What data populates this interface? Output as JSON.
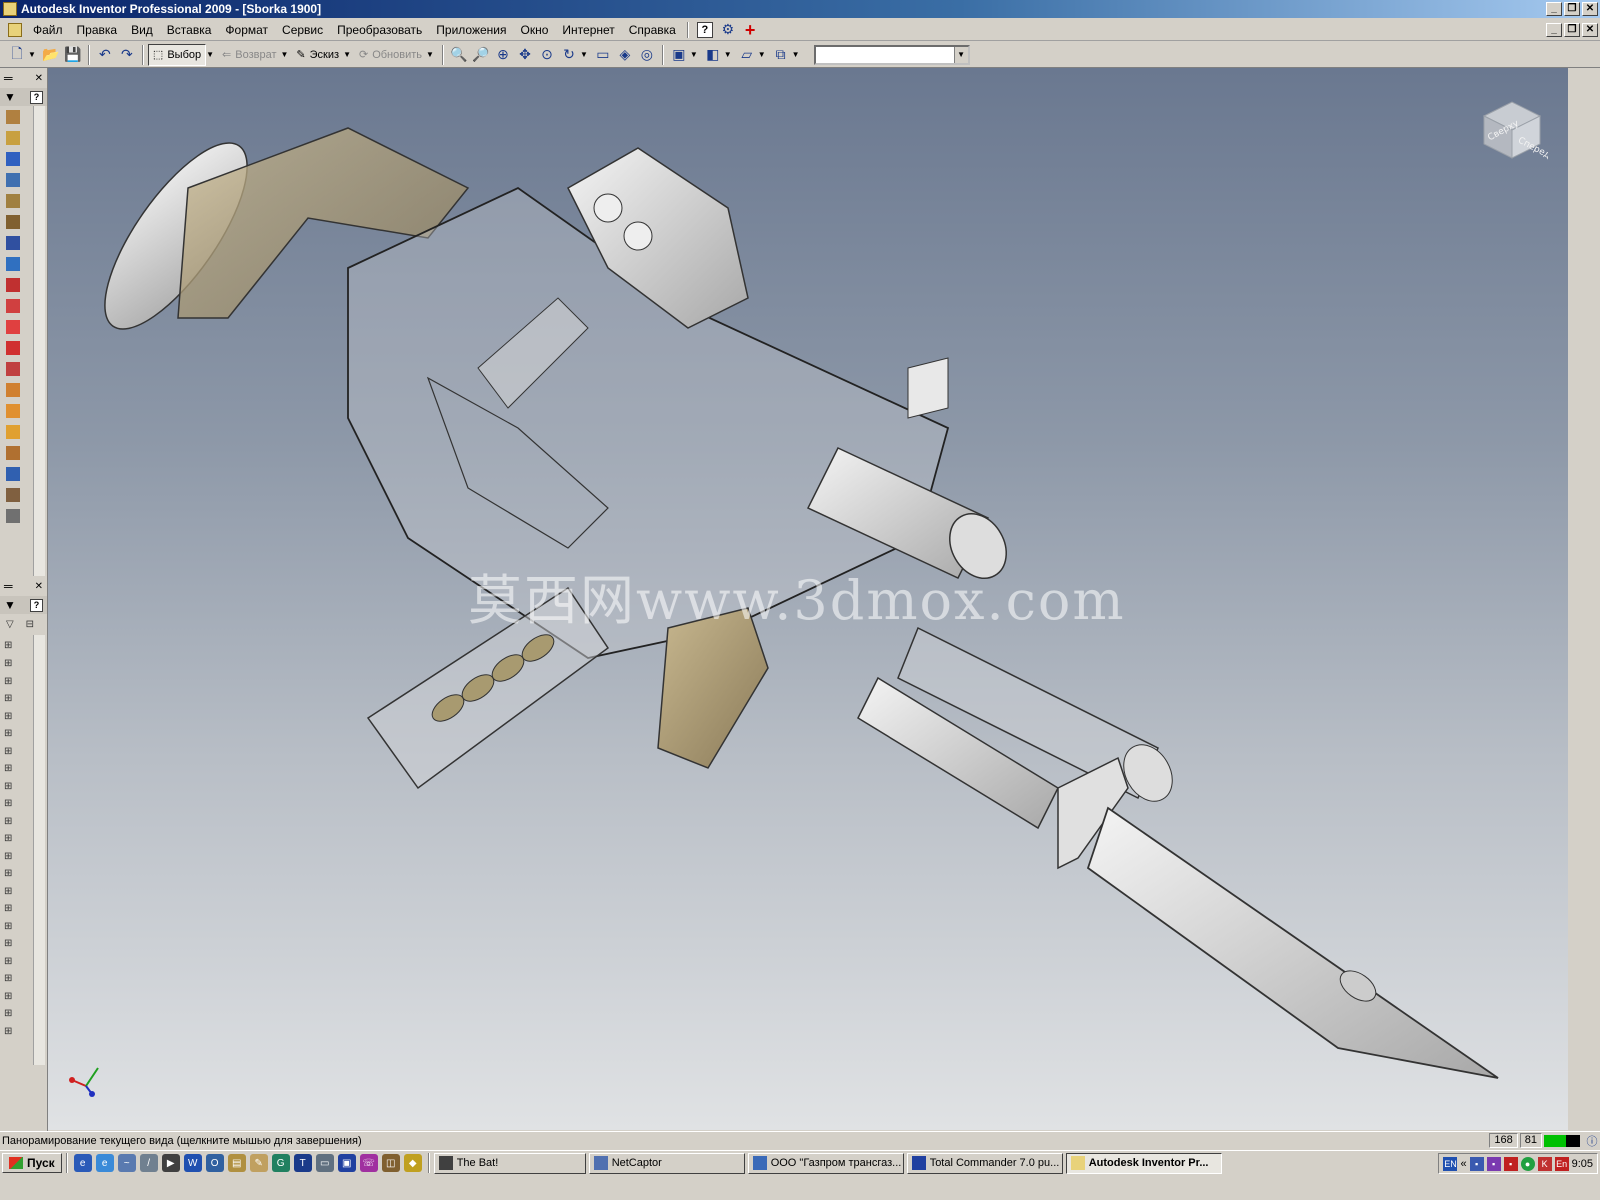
{
  "window": {
    "title": "Autodesk Inventor Professional 2009 - [Sborka 1900]"
  },
  "menu": {
    "items": [
      "Файл",
      "Правка",
      "Вид",
      "Вставка",
      "Формат",
      "Сервис",
      "Преобразовать",
      "Приложения",
      "Окно",
      "Интернет",
      "Справка"
    ]
  },
  "toolbar": {
    "select_label": "Выбор",
    "return_label": "Возврат",
    "sketch_label": "Эскиз",
    "update_label": "Обновить",
    "combo_value": ""
  },
  "viewport": {
    "watermark": "莫西网www.3dmox.com",
    "viewcube_faces": [
      "Сверху",
      "Спереди"
    ],
    "model": "rifle assembly with bayonet"
  },
  "browser": {
    "tree_rows": 24
  },
  "status": {
    "message": "Панорамирование текущего вида (щелкните мышью для завершения)",
    "field1": "168",
    "field2": "81",
    "meter_level": 0.6
  },
  "taskbar": {
    "start_label": "Пуск",
    "tasks": [
      "The Bat!",
      "NetCaptor",
      "ООО \"Газпром трансгаз...",
      "Total Commander 7.0 pu...",
      "Autodesk Inventor Pr..."
    ],
    "active_task_index": 4,
    "tray": {
      "lang": "EN",
      "lang2": "En",
      "clock": "9:05"
    }
  },
  "colors": {
    "titlebar": "#0a246a",
    "viewport_top": "#6a7890",
    "viewport_bottom": "#e0e2e4"
  }
}
